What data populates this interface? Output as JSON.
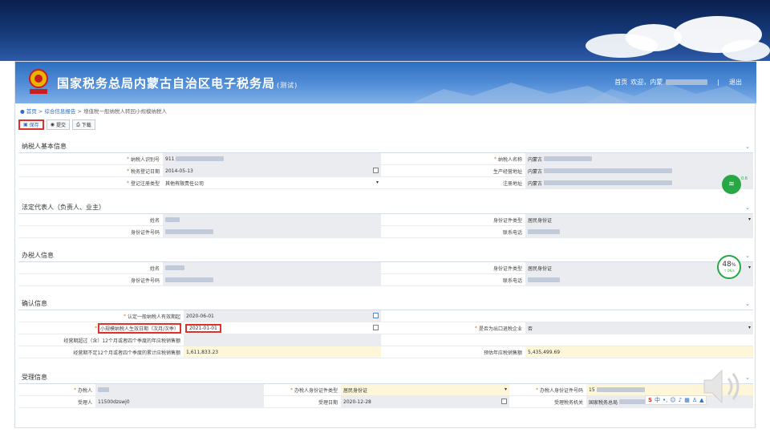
{
  "app": {
    "title": "国家税务总局内蒙古自治区电子税务局",
    "title_suffix": "(测试)",
    "nav_home": "首页",
    "welcome": "欢迎，内蒙",
    "divider": "|",
    "logout": "退出",
    "emblem_text": "中国税务"
  },
  "breadcrumb": {
    "home": "首页",
    "sep": ">",
    "parent": "综合信息报告",
    "current": "增值税一般纳税人转回小规模纳税人"
  },
  "toolbar": {
    "save": "保存",
    "submit": "提交",
    "download": "下载"
  },
  "sections": {
    "basic": {
      "title": "纳税人基本信息",
      "tax_id_label": "纳税人识别号",
      "tax_id_value": "911",
      "name_label": "纳税人名称",
      "name_value": "内蒙古",
      "reg_date_label": "税务登记日期",
      "reg_date_value": "2014-05-13",
      "biz_addr_label": "生产经营地址",
      "biz_addr_value": "内蒙古",
      "reg_type_label": "登记注册类型",
      "reg_type_value": "其他有限责任公司",
      "reg_addr_label": "注册地址",
      "reg_addr_value": "内蒙古"
    },
    "legal": {
      "title": "法定代表人（负责人、业主）",
      "name_label": "姓名",
      "id_type_label": "身份证件类型",
      "id_type_value": "居民身份证",
      "id_no_label": "身份证件号码",
      "phone_label": "联系电话"
    },
    "agent": {
      "title": "办税人信息",
      "name_label": "姓名",
      "id_type_label": "身份证件类型",
      "id_type_value": "居民身份证",
      "id_no_label": "身份证件号码",
      "phone_label": "联系电话"
    },
    "confirm": {
      "title": "确认信息",
      "general_date_label": "认定一般纳税人有效期起",
      "general_date_value": "2020-06-01",
      "small_date_label": "小规模纳税人生效日期（次月/次季）",
      "small_date_value": "2021-01-01",
      "export_label": "是否为出口退税企业",
      "export_value": "否",
      "over12_label": "经营期超过（含）12个月或者四个季度的年应税销售额",
      "under12_label": "经营期不足12个月或者四个季度的累计应税销售额",
      "under12_value": "1,611,833.23",
      "estimate_label": "预估年应税销售额",
      "estimate_value": "5,435,499.69"
    },
    "accept": {
      "title": "受理信息",
      "agent_label": "办税人",
      "agent_id_type_label": "办税人身份证件类型",
      "agent_id_type_value": "居民身份证",
      "agent_id_no_label": "办税人身份证件号码",
      "agent_id_no_value": "15",
      "receiver_label": "受理人",
      "receiver_value": "11500dzswj0",
      "accept_date_label": "受理日期",
      "accept_date_value": "2020-12-28",
      "office_label": "受理税务机关",
      "office_value": "国家税务总局"
    }
  },
  "overlays": {
    "wifi_text": "0.6",
    "percent": "48",
    "percent_unit": "%",
    "percent_sub": "↑ 0K/s"
  },
  "colors": {
    "accent": "#2b6cc4",
    "highlight": "#e0322c",
    "required": "#e07d10"
  }
}
